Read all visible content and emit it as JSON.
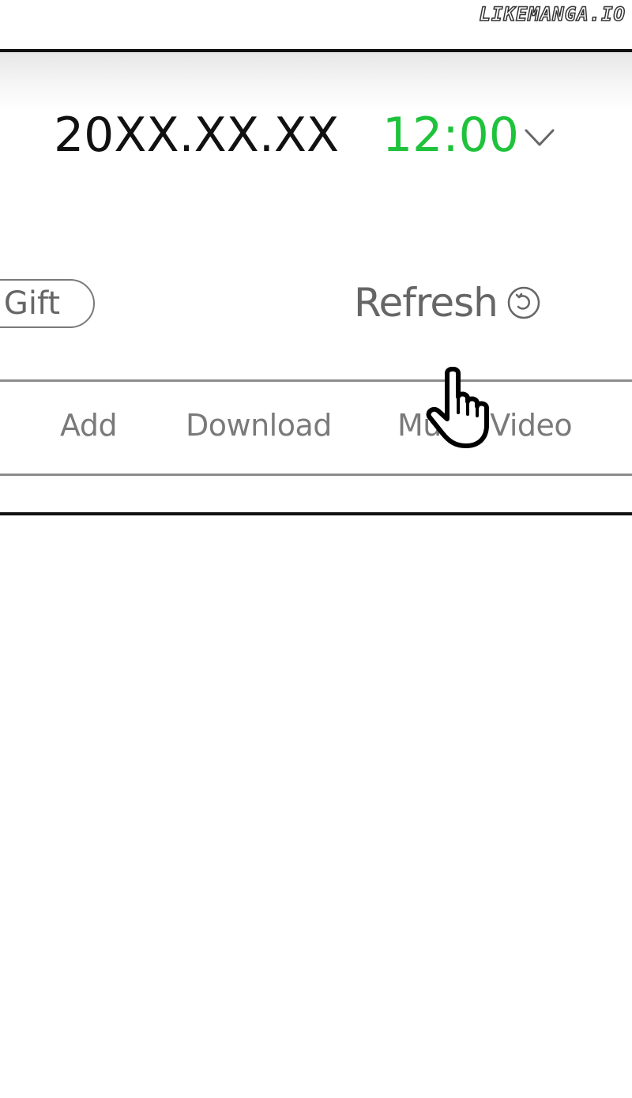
{
  "watermark": "LIKEMANGA.IO",
  "header": {
    "date": "20XX.XX.XX",
    "time": "12:00",
    "time_color": "#1ec33b",
    "dropdown_icon": "chevron-down-icon"
  },
  "actions": {
    "gift_label": "Gift",
    "refresh_label": "Refresh",
    "refresh_icon": "refresh-icon"
  },
  "menu": {
    "items": [
      {
        "label": "Add"
      },
      {
        "label": "Download"
      },
      {
        "label": "Music Video"
      }
    ]
  },
  "cursor": {
    "icon": "hand-pointer-icon"
  }
}
